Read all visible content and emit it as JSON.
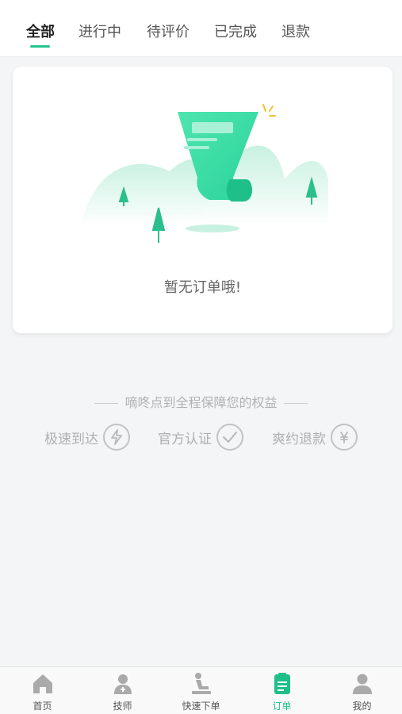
{
  "tabs": [
    {
      "label": "全部",
      "active": true
    },
    {
      "label": "进行中",
      "active": false
    },
    {
      "label": "待评价",
      "active": false
    },
    {
      "label": "已完成",
      "active": false
    },
    {
      "label": "退款",
      "active": false
    }
  ],
  "empty_state": {
    "message": "暂无订单哦!"
  },
  "guarantee": {
    "title": "嘀咚点到全程保障您的权益",
    "items": [
      {
        "label": "极速到达",
        "icon": "lightning-icon"
      },
      {
        "label": "官方认证",
        "icon": "checkmark-icon"
      },
      {
        "label": "爽约退款",
        "icon": "refund-yen-icon"
      }
    ]
  },
  "bottom_nav": [
    {
      "label": "首页",
      "icon": "home-icon",
      "active": false
    },
    {
      "label": "技师",
      "icon": "technician-icon",
      "active": false
    },
    {
      "label": "快速下单",
      "icon": "massage-icon",
      "active": false
    },
    {
      "label": "订单",
      "icon": "order-icon",
      "active": true
    },
    {
      "label": "我的",
      "icon": "profile-icon",
      "active": false
    }
  ],
  "colors": {
    "accent": "#23c48f",
    "background": "#f4f5f7",
    "muted_text": "#b0b0b0"
  }
}
